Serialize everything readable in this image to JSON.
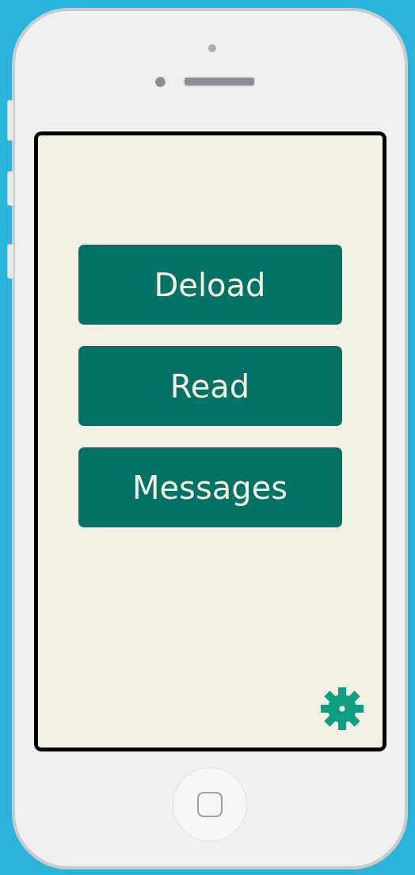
{
  "buttons": [
    {
      "label": "Deload"
    },
    {
      "label": "Read"
    },
    {
      "label": "Messages"
    }
  ]
}
